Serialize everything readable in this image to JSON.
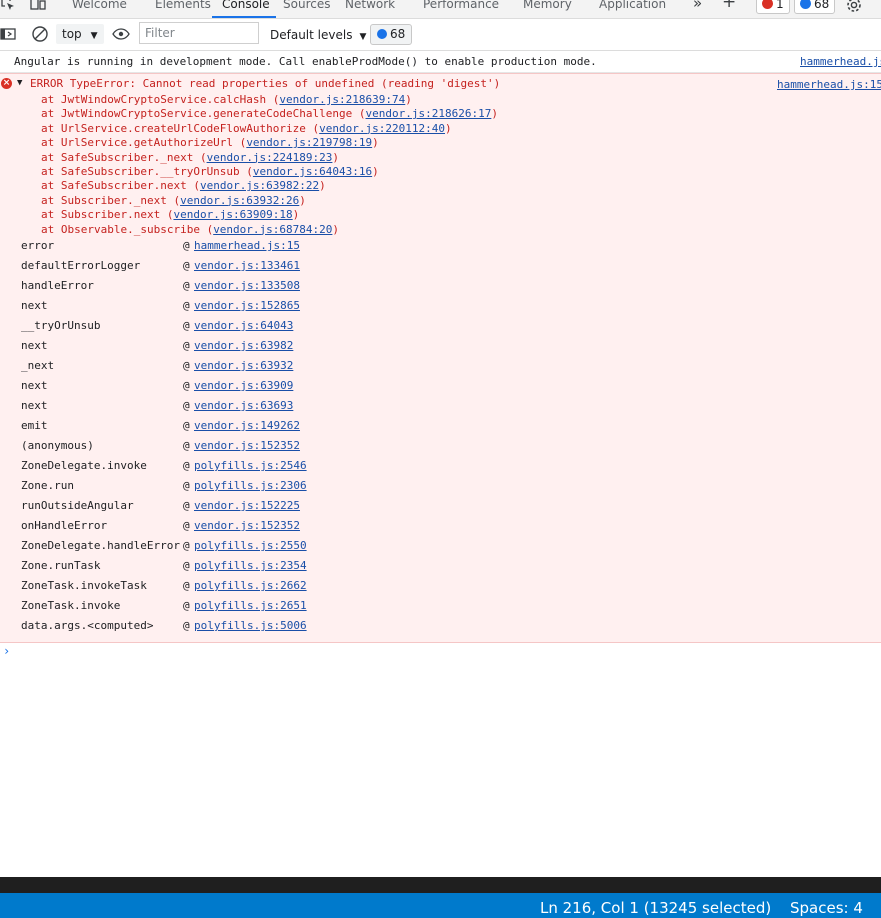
{
  "tabs": [
    {
      "label": "Welcome",
      "active": false
    },
    {
      "label": "Elements",
      "active": false
    },
    {
      "label": "Console",
      "active": true
    },
    {
      "label": "Sources",
      "active": false
    },
    {
      "label": "Network",
      "active": false
    },
    {
      "label": "Performance",
      "active": false
    },
    {
      "label": "Memory",
      "active": false
    },
    {
      "label": "Application",
      "active": false
    }
  ],
  "tabbar": {
    "more_tabs": "»",
    "add_tab": "+",
    "error_count": "1",
    "message_count": "68",
    "icons": [
      "inspect-icon",
      "device-toolbar-icon",
      "more-tabs-icon",
      "add-tab-icon",
      "error-badge-icon",
      "message-badge-icon",
      "settings-icon"
    ]
  },
  "toolbar": {
    "context": "top",
    "filter_placeholder": "Filter",
    "filter_value": "",
    "levels": "Default levels",
    "issues_count": "68",
    "icons": [
      "sidebar-toggle-icon",
      "clear-console-icon",
      "live-expression-eye-icon"
    ]
  },
  "console": {
    "info_message": "Angular is running in development mode. Call enableProdMode() to enable production mode.",
    "info_source": "hammerhead.js",
    "error": {
      "header": "ERROR TypeError: Cannot read properties of undefined (reading 'digest')",
      "source": "hammerhead.js:15",
      "trace": [
        {
          "text": "at JwtWindowCryptoService.calcHash (",
          "link": "vendor.js:218639:74",
          "end": ")"
        },
        {
          "text": "at JwtWindowCryptoService.generateCodeChallenge (",
          "link": "vendor.js:218626:17",
          "end": ")"
        },
        {
          "text": "at UrlService.createUrlCodeFlowAuthorize (",
          "link": "vendor.js:220112:40",
          "end": ")"
        },
        {
          "text": "at UrlService.getAuthorizeUrl (",
          "link": "vendor.js:219798:19",
          "end": ")"
        },
        {
          "text": "at SafeSubscriber._next (",
          "link": "vendor.js:224189:23",
          "end": ")"
        },
        {
          "text": "at SafeSubscriber.__tryOrUnsub (",
          "link": "vendor.js:64043:16",
          "end": ")"
        },
        {
          "text": "at SafeSubscriber.next (",
          "link": "vendor.js:63982:22",
          "end": ")"
        },
        {
          "text": "at Subscriber._next (",
          "link": "vendor.js:63932:26",
          "end": ")"
        },
        {
          "text": "at Subscriber.next (",
          "link": "vendor.js:63909:18",
          "end": ")"
        },
        {
          "text": "at Observable._subscribe (",
          "link": "vendor.js:68784:20",
          "end": ")"
        }
      ],
      "stack": [
        {
          "fn": "error",
          "loc": "hammerhead.js:15"
        },
        {
          "fn": "defaultErrorLogger",
          "loc": "vendor.js:133461"
        },
        {
          "fn": "handleError",
          "loc": "vendor.js:133508"
        },
        {
          "fn": "next",
          "loc": "vendor.js:152865"
        },
        {
          "fn": "__tryOrUnsub",
          "loc": "vendor.js:64043"
        },
        {
          "fn": "next",
          "loc": "vendor.js:63982"
        },
        {
          "fn": "_next",
          "loc": "vendor.js:63932"
        },
        {
          "fn": "next",
          "loc": "vendor.js:63909"
        },
        {
          "fn": "next",
          "loc": "vendor.js:63693"
        },
        {
          "fn": "emit",
          "loc": "vendor.js:149262"
        },
        {
          "fn": "(anonymous)",
          "loc": "vendor.js:152352"
        },
        {
          "fn": "ZoneDelegate.invoke",
          "loc": "polyfills.js:2546"
        },
        {
          "fn": "Zone.run",
          "loc": "polyfills.js:2306"
        },
        {
          "fn": "runOutsideAngular",
          "loc": "vendor.js:152225"
        },
        {
          "fn": "onHandleError",
          "loc": "vendor.js:152352"
        },
        {
          "fn": "ZoneDelegate.handleError",
          "loc": "polyfills.js:2550"
        },
        {
          "fn": "Zone.runTask",
          "loc": "polyfills.js:2354"
        },
        {
          "fn": "ZoneTask.invokeTask",
          "loc": "polyfills.js:2662"
        },
        {
          "fn": "ZoneTask.invoke",
          "loc": "polyfills.js:2651"
        },
        {
          "fn": "data.args.<computed>",
          "loc": "polyfills.js:5006"
        }
      ],
      "at_symbol": "@"
    },
    "prompt": "›"
  },
  "statusbar": {
    "position": "Ln 216, Col 1 (13245 selected)",
    "spaces": "Spaces: 4"
  },
  "colors": {
    "accent": "#1a73e8",
    "error_text": "#c5221f",
    "error_bg": "#fff0f0",
    "link": "#1a4fa8",
    "statusbar_bg": "#007acc"
  }
}
